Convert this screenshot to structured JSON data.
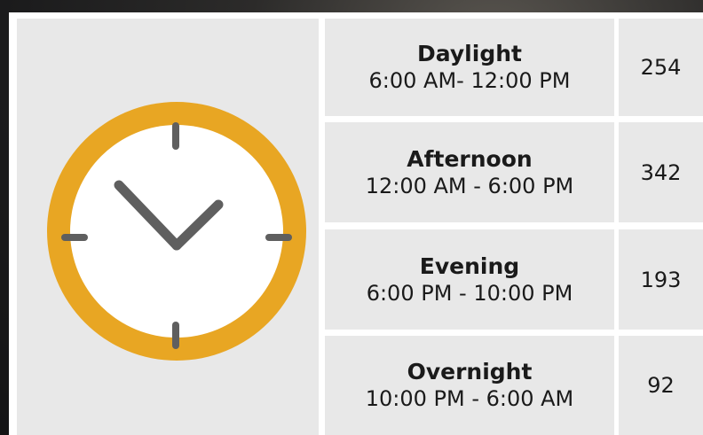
{
  "clock": {
    "icon": "clock-icon",
    "colors": {
      "rim": "#E8A623",
      "face": "#FFFFFF",
      "marks": "#5F5F5F",
      "panel": "#E8E8E8"
    }
  },
  "periods": [
    {
      "name": "Daylight",
      "range": "6:00 AM- 12:00 PM",
      "count": "254"
    },
    {
      "name": "Afternoon",
      "range": "12:00 AM - 6:00 PM",
      "count": "342"
    },
    {
      "name": "Evening",
      "range": "6:00 PM - 10:00 PM",
      "count": "193"
    },
    {
      "name": "Overnight",
      "range": "10:00 PM - 6:00 AM",
      "count": "92"
    }
  ]
}
